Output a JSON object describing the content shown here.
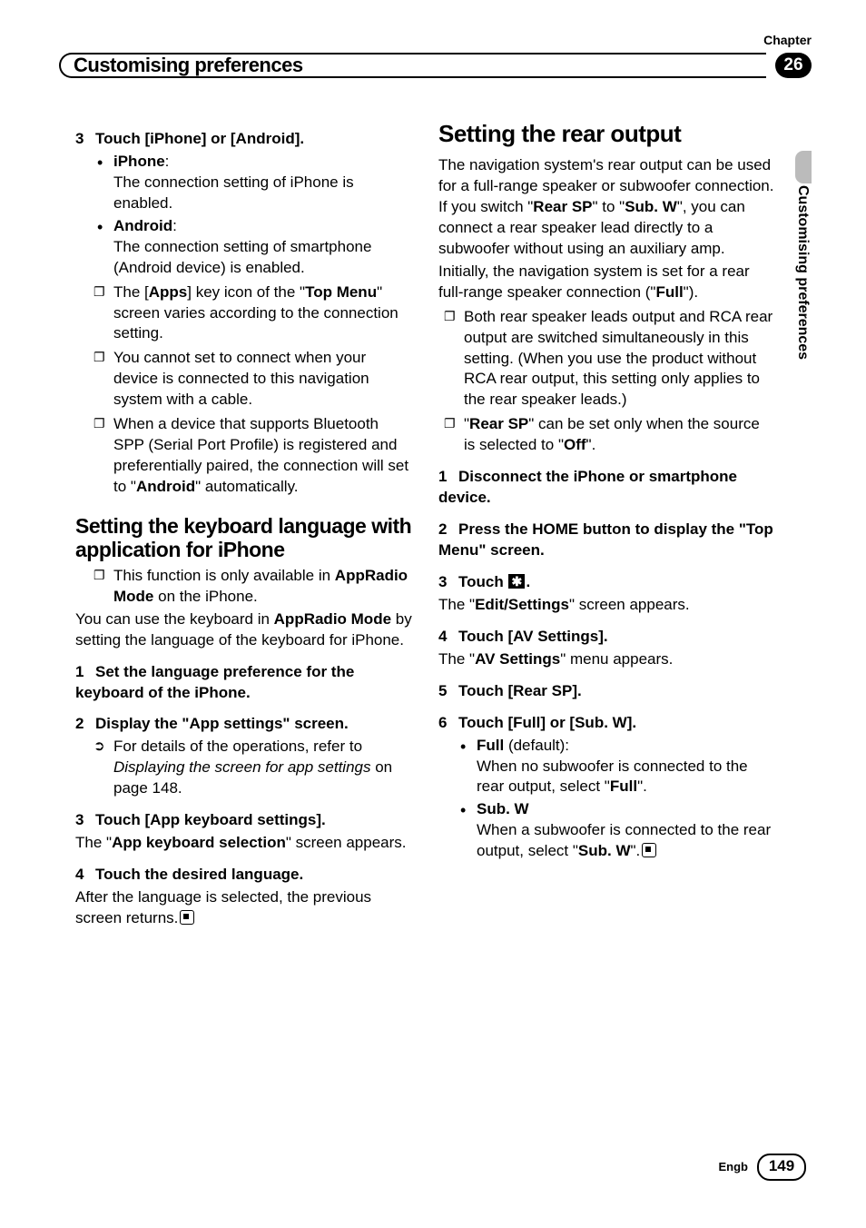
{
  "header": {
    "chapter_label": "Chapter",
    "chapter_number": "26",
    "title": "Customising preferences",
    "side_tab": "Customising preferences"
  },
  "left": {
    "step3": {
      "num": "3",
      "title": "Touch [iPhone] or [Android].",
      "iphone_label": "iPhone",
      "iphone_desc": "The connection setting of iPhone is enabled.",
      "android_label": "Android",
      "android_desc": "The connection setting of smartphone (Android device) is enabled.",
      "note1_a": "The [",
      "note1_apps": "Apps",
      "note1_b": "] key icon of the \"",
      "note1_top": "Top Menu",
      "note1_c": "\" screen varies according to the connection setting.",
      "note2": "You cannot set to connect when your device is connected to this navigation system with a cable.",
      "note3_a": "When a device that supports Bluetooth SPP (Serial Port Profile) is registered and preferentially paired, the connection will set to \"",
      "note3_android": "Android",
      "note3_b": "\" automatically."
    },
    "kb": {
      "heading": "Setting the keyboard language with application for iPhone",
      "note_a": "This function is only available in ",
      "note_b": "AppRadio Mode",
      "note_c": " on the iPhone.",
      "para_a": "You can use the keyboard in ",
      "para_b": "AppRadio Mode",
      "para_c": " by setting the language of the keyboard for iPhone.",
      "s1_num": "1",
      "s1": "Set the language preference for the keyboard of the iPhone.",
      "s2_num": "2",
      "s2": "Display the \"App settings\" screen.",
      "xref_a": "For details of the operations, refer to ",
      "xref_i": "Displaying the screen for app settings",
      "xref_b": " on page 148.",
      "s3_num": "3",
      "s3": "Touch [App keyboard settings].",
      "s3_desc_a": "The \"",
      "s3_desc_b": "App keyboard selection",
      "s3_desc_c": "\" screen appears.",
      "s4_num": "4",
      "s4": "Touch the desired language.",
      "s4_desc": "After the language is selected, the previous screen returns."
    }
  },
  "right": {
    "heading": "Setting the rear output",
    "p1_a": "The navigation system's rear output can be used for a full-range speaker or subwoofer connection. If you switch \"",
    "p1_rear": "Rear SP",
    "p1_b": "\" to \"",
    "p1_sub": "Sub. W",
    "p1_c": "\", you can connect a rear speaker lead directly to a subwoofer without using an auxiliary amp.",
    "p2_a": "Initially, the navigation system is set for a rear full-range speaker connection (\"",
    "p2_full": "Full",
    "p2_b": "\").",
    "note1": "Both rear speaker leads output and RCA rear output are switched simultaneously in this setting. (When you use the product without RCA rear output, this setting only applies to the rear speaker leads.)",
    "note2_a": "\"",
    "note2_rear": "Rear SP",
    "note2_b": "\" can be set only when the source is selected to \"",
    "note2_off": "Off",
    "note2_c": "\".",
    "s1_num": "1",
    "s1": "Disconnect the iPhone or smartphone device.",
    "s2_num": "2",
    "s2": "Press the HOME button to display the \"Top Menu\" screen.",
    "s3_num": "3",
    "s3_a": "Touch ",
    "s3_b": ".",
    "s3_desc_a": "The \"",
    "s3_desc_b": "Edit/Settings",
    "s3_desc_c": "\" screen appears.",
    "s4_num": "4",
    "s4": "Touch [AV Settings].",
    "s4_desc_a": "The \"",
    "s4_desc_b": "AV Settings",
    "s4_desc_c": "\" menu appears.",
    "s5_num": "5",
    "s5": "Touch [Rear SP].",
    "s6_num": "6",
    "s6": "Touch [Full] or [Sub. W].",
    "full_label": "Full",
    "full_default": " (default):",
    "full_desc_a": "When no subwoofer is connected to the rear output, select \"",
    "full_desc_b": "Full",
    "full_desc_c": "\".",
    "sub_label": "Sub. W",
    "sub_desc_a": "When a subwoofer is connected to the rear output, select \"",
    "sub_desc_b": "Sub. W",
    "sub_desc_c": "\"."
  },
  "footer": {
    "lang": "Engb",
    "page": "149"
  }
}
